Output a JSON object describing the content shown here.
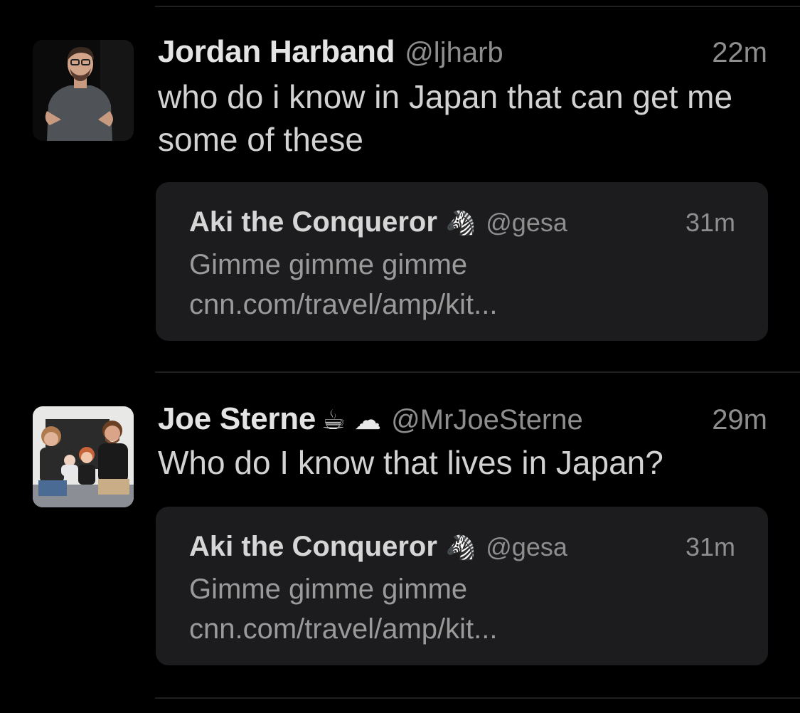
{
  "timeline": {
    "tweets": [
      {
        "author_name": "Jordan Harband",
        "author_emoji": "",
        "handle": "@ljharb",
        "time": "22m",
        "text": "who do i know in Japan that can get me some of these",
        "avatar_icon": "person-avatar",
        "quote": {
          "author_name": "Aki the Conqueror",
          "author_emoji": "🦓",
          "handle": "@gesa",
          "time": "31m",
          "text": "Gimme gimme gimme cnn.com/travel/amp/kit..."
        }
      },
      {
        "author_name": "Joe Sterne",
        "author_emoji": "☕ ☁",
        "handle": "@MrJoeSterne",
        "time": "29m",
        "text": "Who do I know that lives in Japan?",
        "avatar_icon": "family-avatar",
        "quote": {
          "author_name": "Aki the Conqueror",
          "author_emoji": "🦓",
          "handle": "@gesa",
          "time": "31m",
          "text": "Gimme gimme gimme cnn.com/travel/amp/kit..."
        }
      }
    ]
  },
  "colors": {
    "background": "#000000",
    "card": "#1c1c1e",
    "divider": "#1f1f1f",
    "secondary_text": "#8e8e8e"
  }
}
